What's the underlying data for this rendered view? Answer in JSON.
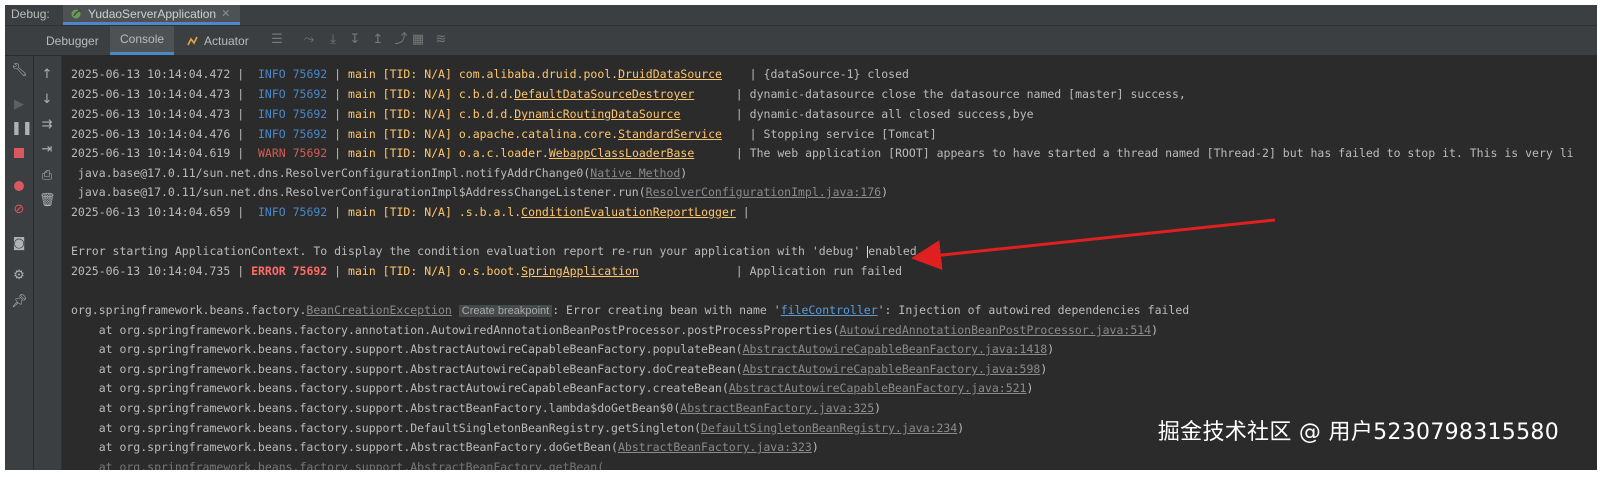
{
  "debug_label": "Debug:",
  "run_tab": "YudaoServerApplication",
  "tabs": {
    "debugger": "Debugger",
    "console": "Console",
    "actuator": "Actuator"
  },
  "lines": {
    "l1": {
      "ts": "2025-06-13 10:14:04.472",
      "sep": "|",
      "lvl": "INFO 75692",
      "thr": "main [TID: N/A]",
      "pkg": "com.alibaba.druid.pool.",
      "cls": "DruidDataSource",
      "msg": "{dataSource-1} closed"
    },
    "l2": {
      "ts": "2025-06-13 10:14:04.473",
      "sep": "|",
      "lvl": "INFO 75692",
      "thr": "main [TID: N/A]",
      "pkg": "c.b.d.d.",
      "cls": "DefaultDataSourceDestroyer",
      "msg": "dynamic-datasource close the datasource named [master] success,"
    },
    "l3": {
      "ts": "2025-06-13 10:14:04.473",
      "sep": "|",
      "lvl": "INFO 75692",
      "thr": "main [TID: N/A]",
      "pkg": "c.b.d.d.",
      "cls": "DynamicRoutingDataSource",
      "msg": "dynamic-datasource all closed success,bye"
    },
    "l4": {
      "ts": "2025-06-13 10:14:04.476",
      "sep": "|",
      "lvl": "INFO 75692",
      "thr": "main [TID: N/A]",
      "pkg": "o.apache.catalina.core.",
      "cls": "StandardService",
      "msg": "Stopping service [Tomcat]"
    },
    "l5": {
      "ts": "2025-06-13 10:14:04.619",
      "sep": "|",
      "lvl": "WARN 75692",
      "thr": "main [TID: N/A]",
      "pkg": "o.a.c.loader.",
      "cls": "WebappClassLoaderBase",
      "msg": "The web application [ROOT] appears to have started a thread named [Thread-2] but has failed to stop it. This is very li"
    },
    "l6": {
      "text": " java.base@17.0.11/sun.net.dns.ResolverConfigurationImpl.notifyAddrChange0(",
      "link": "Native Method",
      "end": ")"
    },
    "l7": {
      "text": " java.base@17.0.11/sun.net.dns.ResolverConfigurationImpl$AddressChangeListener.run(",
      "link": "ResolverConfigurationImpl.java:176",
      "end": ")"
    },
    "l8": {
      "ts": "2025-06-13 10:14:04.659",
      "sep": "|",
      "lvl": "INFO 75692",
      "thr": "main [TID: N/A]",
      "pkg": ".s.b.a.l.",
      "cls": "ConditionEvaluationReportLogger",
      "msg": ""
    },
    "l9": {
      "text": "Error starting ApplicationContext. To display the condition evaluation report re-run your application with 'debug' ",
      "after": "enabled."
    },
    "l10": {
      "ts": "2025-06-13 10:14:04.735",
      "sep": "|",
      "lvl": "ERROR 75692",
      "thr": "main [TID: N/A]",
      "pkg": "o.s.boot.",
      "cls": "SpringApplication",
      "msg": "Application run failed"
    },
    "l11": {
      "pre": "org.springframework.beans.factory.",
      "exc": "BeanCreationException",
      "bp": "Create breakpoint",
      "mid": ": Error creating bean with name '",
      "bean": "fileController",
      "post": "': Injection of autowired dependencies failed"
    },
    "s1": {
      "text": "    at org.springframework.beans.factory.annotation.AutowiredAnnotationBeanPostProcessor.postProcessProperties(",
      "link": "AutowiredAnnotationBeanPostProcessor.java:514",
      "end": ")"
    },
    "s2": {
      "text": "    at org.springframework.beans.factory.support.AbstractAutowireCapableBeanFactory.populateBean(",
      "link": "AbstractAutowireCapableBeanFactory.java:1418",
      "end": ")"
    },
    "s3": {
      "text": "    at org.springframework.beans.factory.support.AbstractAutowireCapableBeanFactory.doCreateBean(",
      "link": "AbstractAutowireCapableBeanFactory.java:598",
      "end": ")"
    },
    "s4": {
      "text": "    at org.springframework.beans.factory.support.AbstractAutowireCapableBeanFactory.createBean(",
      "link": "AbstractAutowireCapableBeanFactory.java:521",
      "end": ")"
    },
    "s5": {
      "text": "    at org.springframework.beans.factory.support.AbstractBeanFactory.lambda$doGetBean$0(",
      "link": "AbstractBeanFactory.java:325",
      "end": ")"
    },
    "s6": {
      "text": "    at org.springframework.beans.factory.support.DefaultSingletonBeanRegistry.getSingleton(",
      "link": "DefaultSingletonBeanRegistry.java:234",
      "end": ")"
    },
    "s7": {
      "text": "    at org.springframework.beans.factory.support.AbstractBeanFactory.doGetBean(",
      "link": "AbstractBeanFactory.java:323",
      "end": ")"
    }
  },
  "watermark": "掘金技术社区 @ 用户5230798315580",
  "colors": {
    "arrow": "#e02020",
    "info": "#4a88c7",
    "warn": "#d35d55",
    "error": "#ff6b68",
    "thread": "#ffc66d"
  }
}
